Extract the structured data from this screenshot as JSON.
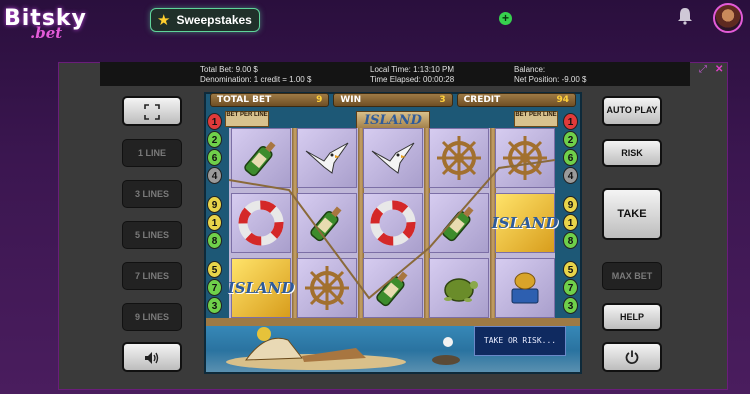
{
  "brand": {
    "name": "Bitsky",
    "sub": ".bet"
  },
  "header": {
    "sweepstakes_label": "Sweepstakes",
    "add_icon": "plus-icon",
    "bell_icon": "bell-icon"
  },
  "info": {
    "total_bet": "Total Bet: 9.00 $",
    "denomination": "Denomination: 1 credit = 1.00 $",
    "local_time": "Local Time: 1:13:10 PM",
    "time_elapsed": "Time Elapsed: 00:00:28",
    "balance": "Balance:",
    "net_position": "Net Position: -9.00 $"
  },
  "left_buttons": {
    "fullscreen_icon": "fullscreen-icon",
    "lines": [
      "1 LINE",
      "3 LINES",
      "5 LINES",
      "7 LINES",
      "9 LINES"
    ],
    "sound_icon": "speaker-icon"
  },
  "right_buttons": {
    "auto_play": "AUTO PLAY",
    "risk": "RISK",
    "take": "TAKE",
    "max_bet": "MAX BET",
    "help": "HELP",
    "power_icon": "power-icon"
  },
  "slot": {
    "total_bet_label": "TOTAL BET",
    "total_bet_value": "9",
    "win_label": "WIN",
    "win_value": "3",
    "credit_label": "CREDIT",
    "credit_value": "94",
    "title": "ISLAND",
    "bet_per_line": "BET PER LINE",
    "left_line_numbers": [
      "1",
      "2",
      "6",
      "4",
      "9",
      "1",
      "8",
      "5",
      "7",
      "3"
    ],
    "right_line_numbers": [
      "1",
      "2",
      "6",
      "4",
      "9",
      "1",
      "8",
      "5",
      "7",
      "3"
    ],
    "reels": [
      [
        "bottle",
        "lifebuoy",
        "island"
      ],
      [
        "gull",
        "bottle",
        "wheel"
      ],
      [
        "gull",
        "lifebuoy",
        "bottle"
      ],
      [
        "wheel",
        "bottle",
        "turtle"
      ],
      [
        "wheel",
        "island",
        "can"
      ]
    ],
    "island_symbol": "ISLAND",
    "message": "TAKE OR RISK..."
  }
}
